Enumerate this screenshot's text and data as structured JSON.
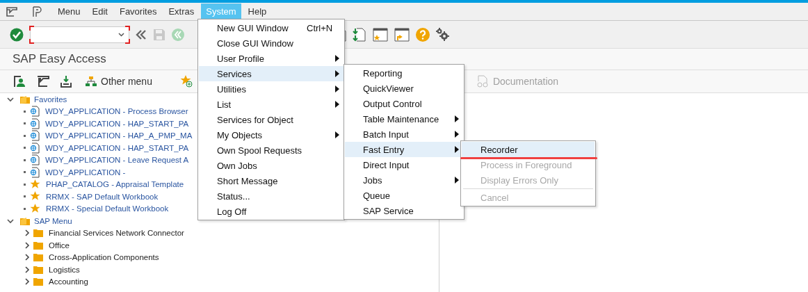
{
  "menu_bar": [
    {
      "label": "Menu",
      "selected": false
    },
    {
      "label": "Edit",
      "selected": false
    },
    {
      "label": "Favorites",
      "selected": false
    },
    {
      "label": "Extras",
      "selected": false
    },
    {
      "label": "System",
      "selected": true
    },
    {
      "label": "Help",
      "selected": false
    }
  ],
  "screen_title": "SAP Easy Access",
  "app_toolbar": {
    "buttons": [
      {
        "label": "Other menu",
        "disabled": false
      },
      {
        "label": "Documentation",
        "disabled": true
      }
    ]
  },
  "tree": [
    {
      "label": "Favorites",
      "expanded": true,
      "children": [
        {
          "label": "WDY_APPLICATION - Process Browser",
          "kind": "web"
        },
        {
          "label": "WDY_APPLICATION - HAP_START_PA",
          "kind": "web"
        },
        {
          "label": "WDY_APPLICATION - HAP_A_PMP_MA",
          "kind": "web"
        },
        {
          "label": "WDY_APPLICATION - HAP_START_PA",
          "kind": "web"
        },
        {
          "label": "WDY_APPLICATION - Leave Request A",
          "kind": "web"
        },
        {
          "label": "WDY_APPLICATION -",
          "kind": "web"
        },
        {
          "label": "PHAP_CATALOG - Appraisal Template",
          "kind": "star"
        },
        {
          "label": "RRMX - SAP Default Workbook",
          "kind": "star"
        },
        {
          "label": "RRMX - Special Default Workbook",
          "kind": "star"
        }
      ]
    },
    {
      "label": "SAP Menu",
      "expanded": true,
      "children": [
        {
          "label": "Financial Services Network Connector",
          "kind": "folder",
          "expanded": false
        },
        {
          "label": "Office",
          "kind": "folder",
          "expanded": false
        },
        {
          "label": "Cross-Application Components",
          "kind": "folder",
          "expanded": false
        },
        {
          "label": "Logistics",
          "kind": "folder",
          "expanded": false
        },
        {
          "label": "Accounting",
          "kind": "folder",
          "expanded": false
        }
      ]
    }
  ],
  "system_menu": {
    "items": [
      {
        "label": "New GUI Window",
        "shortcut": "Ctrl+N",
        "submenu": false,
        "selected": false
      },
      {
        "label": "Close GUI Window",
        "submenu": false,
        "selected": false
      },
      {
        "label": "User Profile",
        "submenu": true,
        "selected": false
      },
      {
        "label": "Services",
        "submenu": true,
        "selected": true
      },
      {
        "label": "Utilities",
        "submenu": true,
        "selected": false
      },
      {
        "label": "List",
        "submenu": true,
        "selected": false
      },
      {
        "label": "Services for Object",
        "submenu": false,
        "selected": false
      },
      {
        "label": "My Objects",
        "submenu": true,
        "selected": false
      },
      {
        "label": "Own Spool Requests",
        "submenu": false,
        "selected": false
      },
      {
        "label": "Own Jobs",
        "submenu": false,
        "selected": false
      },
      {
        "label": "Short Message",
        "submenu": false,
        "selected": false
      },
      {
        "label": "Status...",
        "submenu": false,
        "selected": false
      },
      {
        "label": "Log Off",
        "submenu": false,
        "selected": false
      }
    ]
  },
  "services_menu": {
    "items": [
      {
        "label": "Reporting",
        "submenu": false,
        "selected": false
      },
      {
        "label": "QuickViewer",
        "submenu": false,
        "selected": false
      },
      {
        "label": "Output Control",
        "submenu": false,
        "selected": false
      },
      {
        "label": "Table Maintenance",
        "submenu": true,
        "selected": false
      },
      {
        "label": "Batch Input",
        "submenu": true,
        "selected": false
      },
      {
        "label": "Fast Entry",
        "submenu": true,
        "selected": true
      },
      {
        "label": "Direct Input",
        "submenu": false,
        "selected": false
      },
      {
        "label": "Jobs",
        "submenu": true,
        "selected": false
      },
      {
        "label": "Queue",
        "submenu": false,
        "selected": false
      },
      {
        "label": "SAP Service",
        "submenu": false,
        "selected": false
      }
    ]
  },
  "fast_entry_menu": {
    "items": [
      {
        "label": "Recorder",
        "selected": true,
        "disabled": false,
        "separator_before": false
      },
      {
        "label": "Process in Foreground",
        "selected": false,
        "disabled": true,
        "separator_before": false
      },
      {
        "label": "Display Errors Only",
        "selected": false,
        "disabled": true,
        "separator_before": false
      },
      {
        "label": "Cancel",
        "selected": false,
        "disabled": true,
        "separator_before": true
      }
    ]
  }
}
